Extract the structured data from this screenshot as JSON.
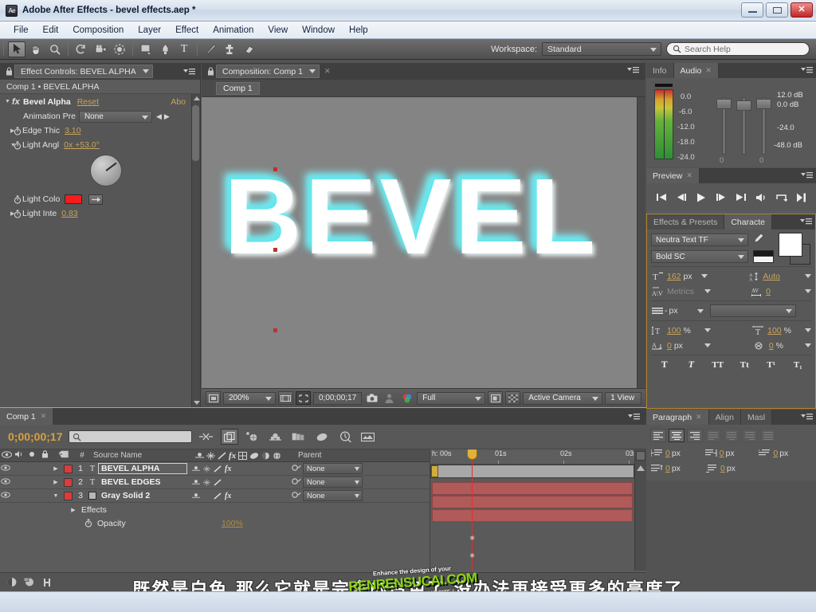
{
  "window": {
    "title": "Adobe After Effects - bevel effects.aep *",
    "app_icon": "ae-icon",
    "minimize": "minimize-icon",
    "maximize": "maximize-icon",
    "close": "close-icon"
  },
  "menubar": {
    "items": [
      "File",
      "Edit",
      "Composition",
      "Layer",
      "Effect",
      "Animation",
      "View",
      "Window",
      "Help"
    ]
  },
  "toolbar": {
    "tools": [
      {
        "name": "selection-tool",
        "glyph": "➤",
        "selected": true
      },
      {
        "name": "hand-tool",
        "glyph": "✋",
        "selected": false
      },
      {
        "name": "zoom-tool",
        "glyph": "🔍",
        "selected": false
      },
      {
        "name": "rotation-tool",
        "glyph": "↺",
        "selected": false
      },
      {
        "name": "camera-tool",
        "glyph": "🎥",
        "selected": false
      },
      {
        "name": "pan-behind-tool",
        "glyph": "⨁",
        "selected": false
      },
      {
        "name": "shape-tool",
        "glyph": "■",
        "selected": false
      },
      {
        "name": "pen-tool",
        "glyph": "✒",
        "selected": false
      },
      {
        "name": "type-tool",
        "glyph": "T",
        "selected": false
      },
      {
        "name": "brush-tool",
        "glyph": "✎",
        "selected": false
      },
      {
        "name": "clone-stamp-tool",
        "glyph": "⚓",
        "selected": false
      },
      {
        "name": "eraser-tool",
        "glyph": "▱",
        "selected": false
      }
    ],
    "workspace_label": "Workspace:",
    "workspace_value": "Standard",
    "search_placeholder": "Search Help",
    "search_icon": "search-icon"
  },
  "effect_controls": {
    "tab_title": "Effect Controls: BEVEL ALPHA",
    "lock_icon": "lock-icon",
    "panel_menu_icon": "panel-menu-icon",
    "breadcrumb": "Comp 1 • BEVEL ALPHA",
    "effect_name": "Bevel Alpha",
    "reset": "Reset",
    "about": "Abo",
    "fx_icon": "fx-icon",
    "rows": [
      {
        "label": "Animation Pre",
        "type": "dropdown",
        "value": "None"
      },
      {
        "label": "Edge Thic",
        "type": "prop",
        "value": "3.10",
        "twirl": true,
        "stopwatch": true
      },
      {
        "label": "Light Angl",
        "type": "prop",
        "value": "0x +53.0°",
        "twirl": true,
        "stopwatch": true,
        "expanded": true
      },
      {
        "label": "Light Colo",
        "type": "color",
        "value": "#f51c1c",
        "stopwatch": true
      },
      {
        "label": "Light Inte",
        "type": "prop",
        "value": "0.83",
        "twirl": true,
        "stopwatch": true
      }
    ],
    "dial_angle_deg": 53
  },
  "composition_viewer": {
    "tab_title": "Composition: Comp 1",
    "lock_icon": "lock-icon",
    "close_icon": "close-icon",
    "panel_menu_icon": "panel-menu-icon",
    "comp_tag": "Comp 1",
    "stage_text": "BEVEL",
    "bottom_bar": {
      "magnify_icon": "magnification-icon",
      "zoom": "200%",
      "grid_icon": "choose-grid-icon",
      "mask_icon": "mask-visibility-icon",
      "timecode": "0;00;00;17",
      "snapshot_icon": "snapshot-icon",
      "show_snapshot_icon": "show-snapshot-icon",
      "channel_icon": "show-channel-icon",
      "resolution": "Full",
      "region_icon": "region-of-interest-icon",
      "transparency_icon": "transparency-grid-icon",
      "camera": "Active Camera",
      "views": "1 View"
    }
  },
  "info_audio": {
    "tabs": [
      {
        "label": "Info",
        "active": false
      },
      {
        "label": "Audio",
        "active": true,
        "closable": true
      }
    ],
    "panel_menu_icon": "panel-menu-icon",
    "scale_labels": [
      "0.0",
      "-6.0",
      "-12.0",
      "-18.0",
      "-24.0"
    ],
    "db_labels": [
      "12.0 dB",
      "0.0 dB",
      "-24.0",
      "-48.0 dB"
    ],
    "slider_values": [
      "0",
      "0"
    ]
  },
  "preview": {
    "tab_label": "Preview",
    "close_icon": "close-icon",
    "panel_menu_icon": "panel-menu-icon",
    "buttons": [
      {
        "name": "first-frame-button",
        "glyph": "❘◀"
      },
      {
        "name": "previous-frame-button",
        "glyph": "◀❘"
      },
      {
        "name": "play-button",
        "glyph": "▶"
      },
      {
        "name": "next-frame-button",
        "glyph": "❘▶"
      },
      {
        "name": "last-frame-button",
        "glyph": "▶❘"
      },
      {
        "name": "audio-toggle-button",
        "glyph": "🔊"
      },
      {
        "name": "loop-button",
        "glyph": "↻"
      },
      {
        "name": "ram-preview-button",
        "glyph": "▶❘"
      }
    ]
  },
  "character": {
    "tabs": [
      {
        "label": "Effects & Presets",
        "active": false
      },
      {
        "label": "Characte",
        "active": true
      }
    ],
    "panel_menu_icon": "panel-menu-icon",
    "font_family": "Neutra Text TF",
    "font_style": "Bold SC",
    "eyedropper_icon": "eyedropper-icon",
    "fill_color": "#ffffff",
    "stroke_color": "#000000",
    "font_size": "162",
    "font_size_unit": "px",
    "leading": "Auto",
    "kerning": "Metrics",
    "tracking": "0",
    "stroke_width": "-",
    "stroke_width_unit": "px",
    "stroke_type": "",
    "vertical_scale": "100",
    "vertical_scale_unit": "%",
    "horizontal_scale": "100",
    "horizontal_scale_unit": "%",
    "baseline_shift": "0",
    "baseline_shift_unit": "px",
    "tsume": "0",
    "tsume_unit": "%",
    "style_buttons": [
      "T",
      "T",
      "TT",
      "Tt",
      "T¹",
      "T₁"
    ]
  },
  "paragraph": {
    "tabs": [
      {
        "label": "Paragraph",
        "active": true,
        "closable": true
      },
      {
        "label": "Align",
        "active": false
      },
      {
        "label": "Masl",
        "active": false
      }
    ],
    "panel_menu_icon": "panel-menu-icon",
    "align_buttons": [
      "align-left",
      "align-center",
      "align-right",
      "justify-last-left",
      "justify-last-center",
      "justify-last-right",
      "justify-all"
    ],
    "selected_align": 1,
    "indents": [
      {
        "name": "indent-left-margin",
        "value": "0",
        "unit": "px"
      },
      {
        "name": "indent-right-margin",
        "value": "0",
        "unit": "px"
      },
      {
        "name": "indent-first-line",
        "value": "0",
        "unit": "px"
      },
      {
        "name": "space-before-paragraph",
        "value": "0",
        "unit": "px"
      },
      {
        "name": "space-after-paragraph",
        "value": "0",
        "unit": "px"
      }
    ]
  },
  "timeline": {
    "tab_label": "Comp 1",
    "close_icon": "close-icon",
    "panel_menu_icon": "panel-menu-icon",
    "current_time": "0;00;00;17",
    "search_placeholder": "",
    "search_icon": "search-icon",
    "switch_icons": [
      "composition-mini-flowchart-icon",
      "live-update-icon",
      "draft-3d-icon",
      "hide-shy-layers-icon",
      "frame-blending-icon",
      "motion-blur-icon",
      "graph-editor-icon",
      "brainstorm-icon",
      "auto-keyframe-icon"
    ],
    "columns": {
      "eye": "video-switch-icon",
      "audio": "audio-switch-icon",
      "solo": "solo-switch-icon",
      "lock": "lock-switch-icon",
      "label": "label-icon",
      "num": "#",
      "source_name": "Source Name",
      "switches": [
        "shy-icon",
        "collapse-icon",
        "quality-icon",
        "effects-icon",
        "frame-blend-icon",
        "motion-blur-icon",
        "adjustment-icon",
        "3d-icon"
      ],
      "parent": "Parent"
    },
    "layers": [
      {
        "num": "1",
        "type_icon": "text-layer-icon",
        "name": "BEVEL ALPHA",
        "selected": true,
        "color": "#e03a3a",
        "parent": "None",
        "has_fx": true
      },
      {
        "num": "2",
        "type_icon": "text-layer-icon",
        "name": "BEVEL EDGES",
        "selected": false,
        "color": "#e03a3a",
        "parent": "None",
        "has_fx": false
      },
      {
        "num": "3",
        "type_icon": "solid-layer-icon",
        "name": "Gray Solid 2",
        "selected": false,
        "color": "#e03a3a",
        "parent": "None",
        "has_fx": true,
        "expanded": true
      }
    ],
    "sublayers": [
      {
        "indent": 1,
        "label": "Effects",
        "twirl": true
      },
      {
        "indent": 2,
        "label": "Opacity",
        "value": "100%",
        "stopwatch": true
      }
    ],
    "ruler_ticks": [
      "00s",
      "01s",
      "02s",
      "03s"
    ],
    "ruler_prefix": "h:",
    "bottom_icons": [
      "toggle-switches-modes-icon",
      "comp-flowchart-icon",
      "toggle-graph-icon"
    ]
  },
  "subtitle": {
    "text": "既然是白色  那么它就是完全的白色了  没办法再接受更多的亮度了"
  },
  "watermark": {
    "top": "Enhance the design of your",
    "main": "RENRENSUCAI.COM",
    "bottom": "人人素材  WITH A GREAT SITE !"
  },
  "colors": {
    "accent_orange": "#c8a45c",
    "label_red": "#e03a3a",
    "clip_red": "#b05a5a",
    "playhead": "#e03030",
    "panel_bg": "#5c5c5c",
    "bevel_cyan": "#5fe6ee"
  }
}
